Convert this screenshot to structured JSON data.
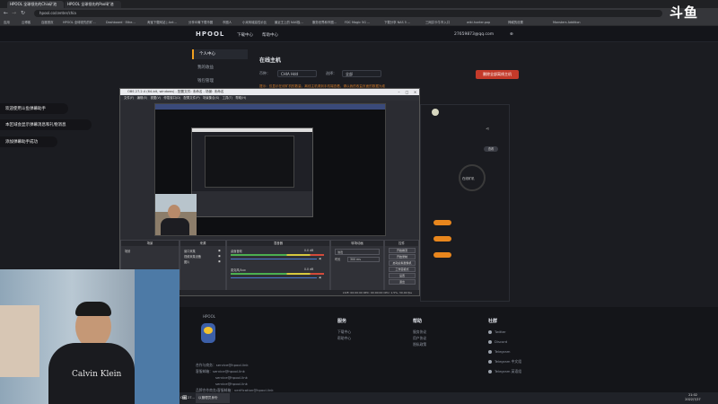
{
  "browser": {
    "tabs": [
      "HPOOL 全球领先的Chia矿池",
      "HPOOL 全球领先的Pool矿池"
    ],
    "address": "hpool.co/center/chia",
    "bookmarks": [
      "应用",
      "云博客",
      "百度首页",
      "HPOOL 全球领先的矿…",
      "Dashboard · Ethe…",
      "淘宝下载网站 | Ant…",
      "分享众筹下载币圈",
      "币圈人",
      "小米商城高性价比",
      "最近王上的 NAS极…",
      "服务世界和币圈…",
      "FDC Magic 5G …",
      "下载分享 NAS 5 …",
      "三网并卡牛市入口",
      "wiki.hunter.pop",
      "神威的设置",
      "Monsters Addition"
    ]
  },
  "site": {
    "logo": "HPOOL",
    "nav": [
      "下载中心",
      "帮助中心"
    ],
    "user_email": "27659873@qq.com",
    "left_menu": [
      "个人中心",
      "我的收益",
      "钱包管理"
    ],
    "content_title": "在线主机",
    "filter_label1": "币种：",
    "filter_value1": "CHIA Hdd",
    "filter_label2": "选择：",
    "filter_value2": "全部",
    "red_button": "删除全部离线主机",
    "notice": "提示：仅显示在线矿机的数量，离线主机请到手机端查看，请以我的收益页面的数据为准"
  },
  "overlays": {
    "brand": "斗鱼",
    "chat": [
      "欢迎使用斗鱼弹幕助手",
      "本区域会显示弹幕消息和礼物消息",
      "添加弹幕助手成功"
    ]
  },
  "obs": {
    "title": "OBS 27.2.4 (64-bit, windows) - 配置文件: 未命名 - 场景: 未命名",
    "menu": [
      "文件(F)",
      "编辑(E)",
      "视图(V)",
      "停靠窗口(D)",
      "配置文件(P)",
      "场景集合(S)",
      "工具(T)",
      "帮助(H)"
    ],
    "preview_label": "来源预览",
    "dock_headers": [
      "场景",
      "来源",
      "混音器",
      "转场动画",
      "控件"
    ],
    "scene_items": [
      "场景"
    ],
    "source_items": [
      "窗口采集",
      "视频采集设备",
      "图片"
    ],
    "mixer_tracks": [
      {
        "name": "桌面音频",
        "value": "0.0 dB"
      },
      {
        "name": "麦克风/Aux",
        "value": "0.0 dB"
      }
    ],
    "transition_label": "淡出",
    "duration_label": "时长",
    "duration_value": "300 ms",
    "controls": [
      "开始推流",
      "开始录制",
      "启动虚拟摄像机",
      "工作室模式",
      "设置",
      "退出"
    ],
    "status": "LIVE: 00:00:00   REC: 00:00:00   CPU: 1.5%, 30.00 fps"
  },
  "right_panel": {
    "ring_label": "在线矿机",
    "button_label": "查看"
  },
  "footer": {
    "headings": [
      "服务",
      "帮助",
      "社群"
    ],
    "service_links": [
      "下载中心",
      "帮助中心"
    ],
    "help_links": [
      "服务协议",
      "用户协议",
      "隐私政策"
    ],
    "social": [
      "Twitter",
      "Discord",
      "Telegram",
      "Telegram 中文组",
      "Telegram 英语组"
    ],
    "contacts": [
      "合作与商务：service@hpool.link",
      "客服邮箱：service@hpool.link",
      "service@hpool.link",
      "service@hpool.link",
      "品牌合作商务/客服邮箱：verification@hpool.link"
    ],
    "logo": "HPOOL"
  },
  "taskbar": {
    "items": [
      "OBS 27…",
      "以管理员身份"
    ],
    "time": "21:02",
    "date": "2022/7/27"
  }
}
